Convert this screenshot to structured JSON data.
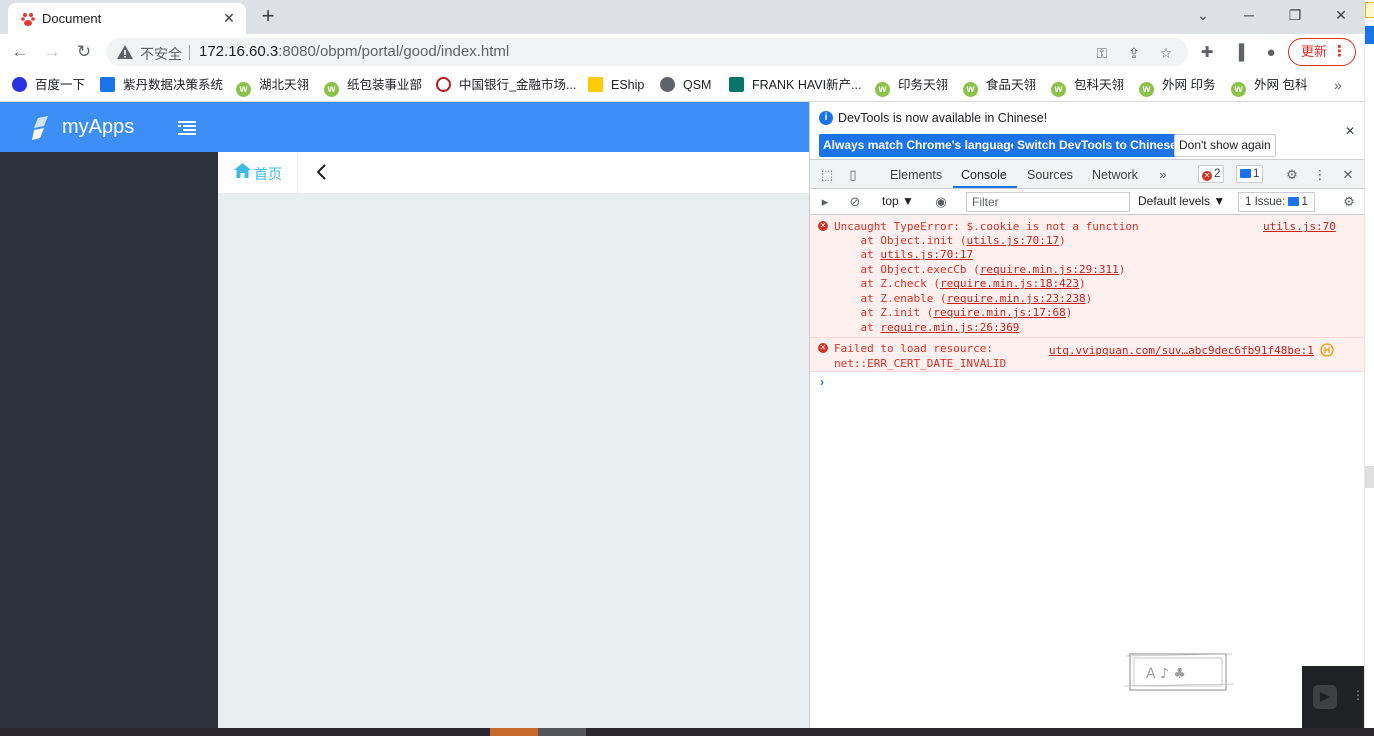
{
  "tab": {
    "title": "Document",
    "close": "✕"
  },
  "window": {
    "new_tab": "+",
    "minimize": "⌄",
    "restore": "─",
    "maximize": "❐",
    "close": "✕"
  },
  "toolbar": {
    "back": "←",
    "forward": "→",
    "reload": "↻",
    "insecure_label": "不安全",
    "url_host": "172.16.60.3",
    "url_path": ":8080/obpm/portal/good/index.html",
    "update_label": "更新",
    "menu_dots": "⋮"
  },
  "bookmarks": [
    {
      "label": "百度一下",
      "icon": "baidu-icon",
      "color": "#2932e1"
    },
    {
      "label": "紫丹数据决策系统",
      "icon": "zidan-icon",
      "color": "#1a73e8"
    },
    {
      "label": "湖北天翎",
      "icon": "w-icon"
    },
    {
      "label": "纸包装事业部",
      "icon": "w-icon"
    },
    {
      "label": "中国银行_金融市场...",
      "icon": "boc-icon",
      "color": "#b71c1c"
    },
    {
      "label": "EShip",
      "icon": "dhl-icon",
      "color": "#ffcc00"
    },
    {
      "label": "QSM",
      "icon": "globe-icon",
      "color": "#5f6368"
    },
    {
      "label": "FRANK HAVI新产...",
      "icon": "forms-icon",
      "color": "#077568"
    },
    {
      "label": "印务天翎",
      "icon": "w-icon"
    },
    {
      "label": "食品天翎",
      "icon": "w-icon"
    },
    {
      "label": "包科天翎",
      "icon": "w-icon"
    },
    {
      "label": "外网 印务",
      "icon": "w-icon"
    },
    {
      "label": "外网 包科",
      "icon": "w-icon"
    }
  ],
  "bookmarks_more": "»",
  "app": {
    "brand": "myApps",
    "home_tab": "首页",
    "back_chevron": "‹",
    "accent": "#3e8ef7",
    "sidebar_color": "#2c313a"
  },
  "devtools": {
    "info_message": "DevTools is now available in Chinese!",
    "btn_match": "Always match Chrome's language",
    "btn_switch": "Switch DevTools to Chinese",
    "btn_dismiss": "Don't show again",
    "tabs": [
      "Elements",
      "Console",
      "Sources",
      "Network"
    ],
    "active_tab": "Console",
    "more_tabs": "»",
    "error_count": "2",
    "message_count": "1",
    "context": "top ▼",
    "filter_placeholder": "Filter",
    "levels": "Default levels ▼",
    "issues_label": "1 Issue:",
    "issues_count": "1",
    "errors": [
      {
        "message": "Uncaught TypeError: $.cookie is not a function",
        "source": "utils.js:70",
        "stack": [
          {
            "prefix": "    at Object.init (",
            "link": "utils.js:70:17",
            "suffix": ")"
          },
          {
            "prefix": "    at ",
            "link": "utils.js:70:17",
            "suffix": ""
          },
          {
            "prefix": "    at Object.execCb (",
            "link": "require.min.js:29:311",
            "suffix": ")"
          },
          {
            "prefix": "    at Z.check (",
            "link": "require.min.js:18:423",
            "suffix": ")"
          },
          {
            "prefix": "    at Z.enable (",
            "link": "require.min.js:23:238",
            "suffix": ")"
          },
          {
            "prefix": "    at Z.init (",
            "link": "require.min.js:17:68",
            "suffix": ")"
          },
          {
            "prefix": "    at ",
            "link": "require.min.js:26:369",
            "suffix": ""
          }
        ]
      },
      {
        "message": "Failed to load resource:",
        "message2": "net::ERR_CERT_DATE_INVALID",
        "source": "utq.vvipquan.com/suv…abc9dec6fb91f48be:1"
      }
    ],
    "prompt": "›"
  }
}
